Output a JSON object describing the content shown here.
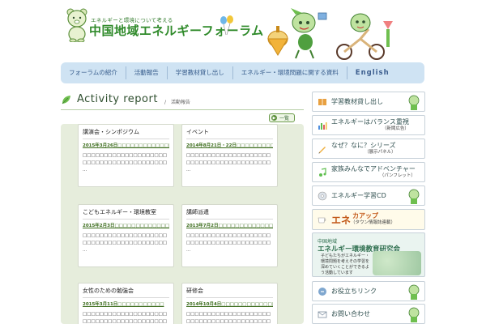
{
  "header": {
    "tagline": "エネルギーと環境について考える",
    "title": "中国地域エネルギーフォーラム"
  },
  "nav": {
    "items": [
      "フォーラムの紹介",
      "活動報告",
      "学習教材貸し出し",
      "エネルギー・環境問題に関する資料",
      "English"
    ]
  },
  "main": {
    "section_title": "Activity report",
    "section_sub": "/　活動報告",
    "list_all_label": "一覧",
    "cards": [
      {
        "title": "講演会・シンポジウム",
        "link": "2015年3月26日□□□□□□□□□□□□□",
        "text": "□□□□□□□□□□□□□□□□□□□□□□□□□□□□□□□□□□□□□□□□ ..."
      },
      {
        "title": "イベント",
        "link": "2014年8月21日・22日□□□□□□□□□□□□□□□",
        "text": "□□□□□□□□□□□□□□□□□□□□□□□□□□□□□□□□□□□□□□□□ ..."
      },
      {
        "title": "こどもエネルギー・環境教室",
        "link": "2015年2月3日□□□□□□□□□□□□□□□□□□□□□□□□",
        "text": "□□□□□□□□□□□□□□□□□□□□□□□□□□□□□□□□□□□□□□□□ ..."
      },
      {
        "title": "講師派遣",
        "link": "2013年7月2日□□□□□□□□□□□□□□□□□□",
        "text": "□□□□□□□□□□□□□□□□□□□□□□□□□□□□□□□□□□□□□□□□ ..."
      },
      {
        "title": "女性のための勉強会",
        "link": "2015年3月11日□□□□□□□□□□□",
        "text": "□□□□□□□□□□□□□□□□□□□□□□□□□□□□□□□□□□□□□□□□ ..."
      },
      {
        "title": "研修会",
        "link": "2014年10月4日□□□□□□□□□□□□□□□□□□",
        "text": "□□□□□□□□□□□□□□□□□□□□□□□□□□□□□□□□□□□□□□□□ ..."
      }
    ]
  },
  "sidebar": {
    "items": [
      {
        "label": "学習教材貸し出し",
        "sub": "",
        "icon": "book-icon"
      },
      {
        "label": "エネルギーはバランス重視",
        "sub": "（新聞広告）",
        "icon": "bar-chart-icon"
      },
      {
        "label": "なぜ？なに？シリーズ",
        "sub": "（展示パネル）",
        "icon": "pencil-icon"
      },
      {
        "label": "家族みんなでアドベンチャー",
        "sub": "（パンフレット）",
        "icon": "music-note-icon"
      },
      {
        "label": "エネルギー学習CD",
        "sub": "",
        "icon": "cd-icon"
      }
    ],
    "ene_banner": {
      "big": "エネ",
      "kana": "カアップ",
      "sub": "（タウン情報誌連載）"
    },
    "kenkyu": {
      "line1": "中国地域",
      "line2": "エネルギー環境教育研究会",
      "desc": "子どもたちがエネルギー・環境問題を考えその学習を深めていくことができるよう活動しています"
    },
    "links": [
      {
        "label": "お役立ちリンク",
        "icon": "chain-link-icon"
      },
      {
        "label": "お問い合わせ",
        "icon": "mail-icon"
      }
    ]
  },
  "colors": {
    "nav_bg": "#cfe3f3",
    "brand_green": "#2f8a2a",
    "cards_bg": "#e6eddc",
    "link_green": "#3a6b1a"
  }
}
